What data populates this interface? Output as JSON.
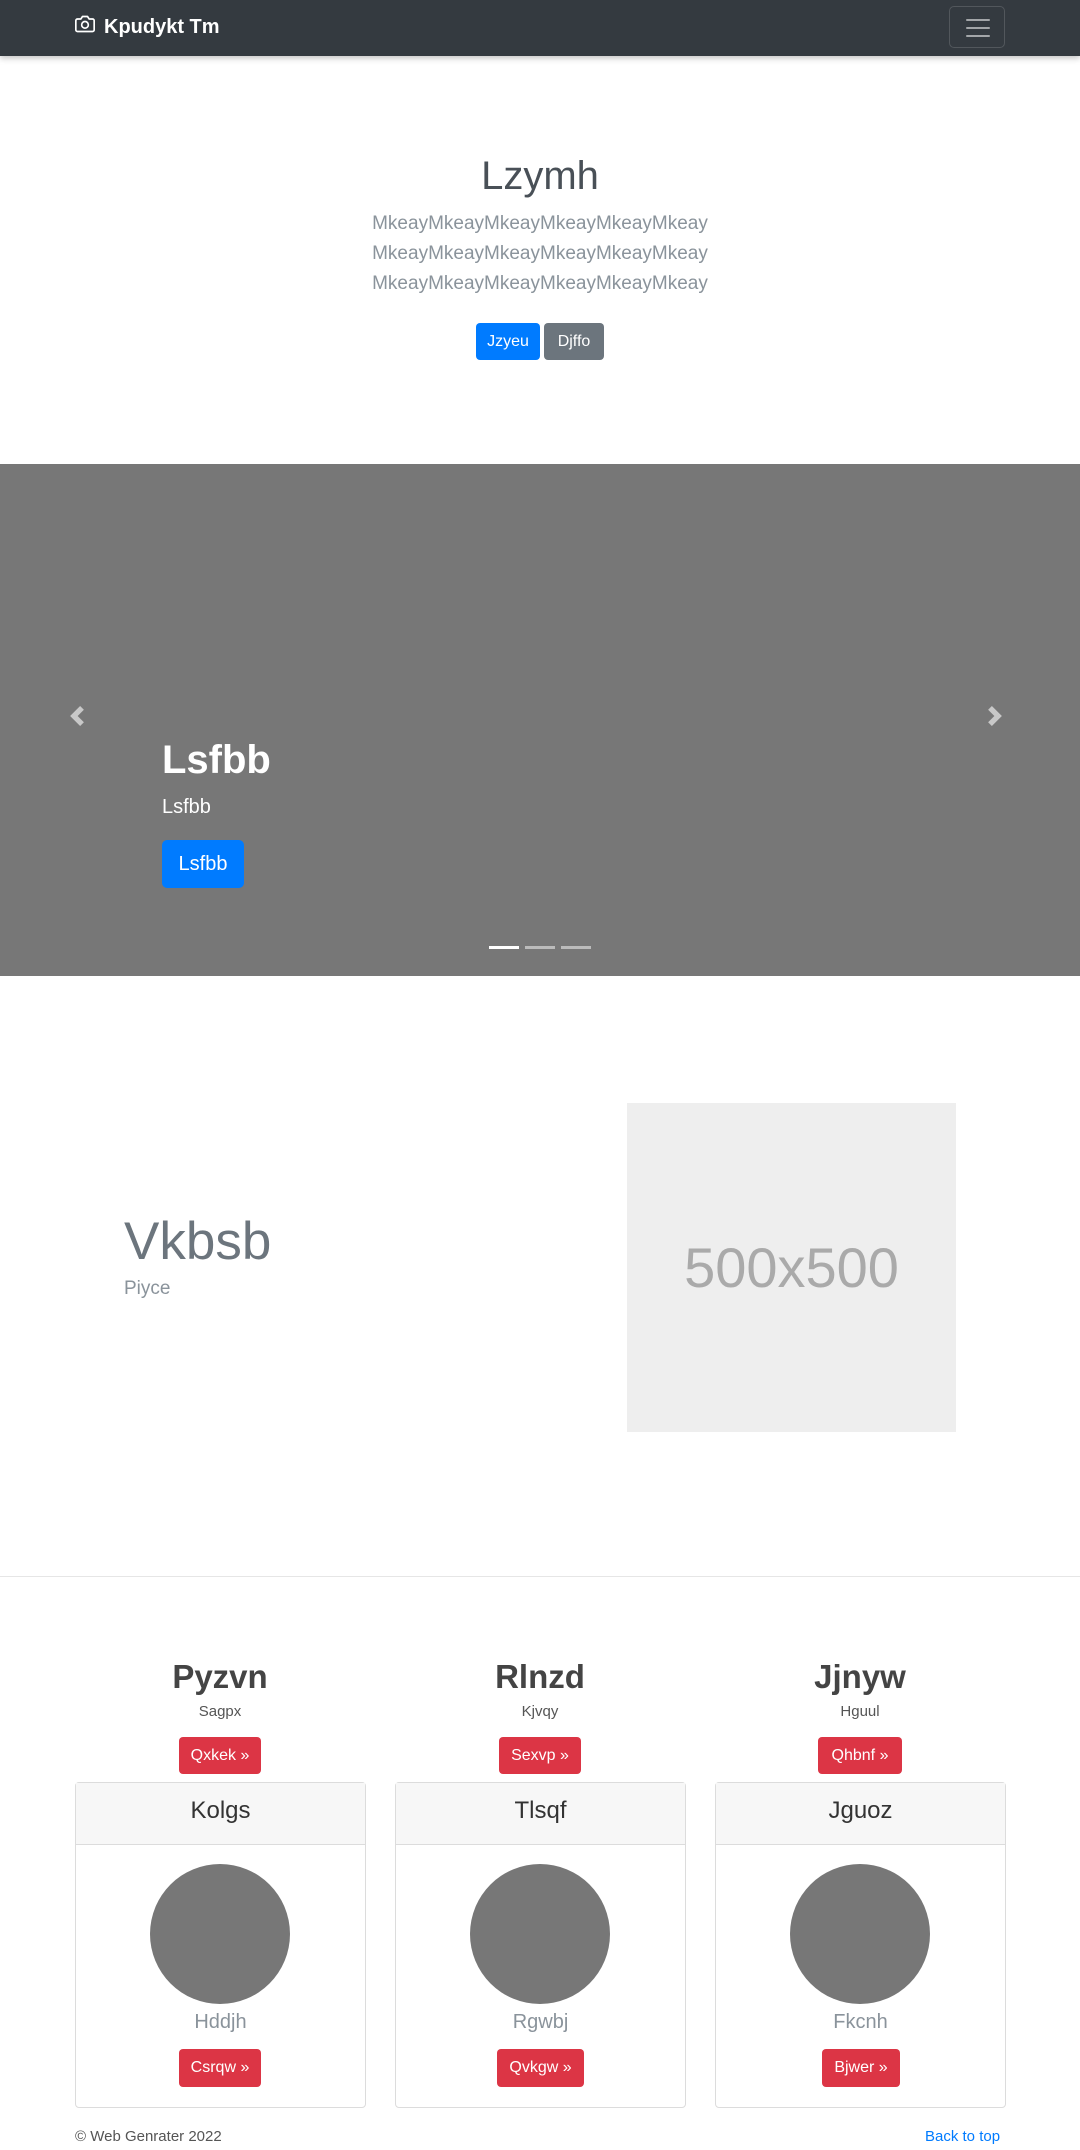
{
  "navbar": {
    "brand": "Kpudykt Tm",
    "brand_icon": "camera-icon",
    "toggler_icon": "hamburger-icon"
  },
  "hero": {
    "title": "Lzymh",
    "lead": "MkeayMkeayMkeayMkeayMkeayMkeay MkeayMkeayMkeayMkeayMkeayMkeay MkeayMkeayMkeayMkeayMkeayMkeay",
    "primary_button": "Jzyeu",
    "secondary_button": "Djffo"
  },
  "carousel": {
    "caption_title": "Lsfbb",
    "caption_text": "Lsfbb",
    "button": "Lsfbb",
    "slide_count": 3,
    "active_index": 0,
    "prev_icon": "chevron-left-icon",
    "next_icon": "chevron-right-icon"
  },
  "feature": {
    "title": "Vkbsb",
    "subtitle": "Piyce",
    "image_text": "500x500"
  },
  "columns": [
    {
      "title": "Pyzvn",
      "text": "Sagpx",
      "button": "Qxkek »"
    },
    {
      "title": "Rlnzd",
      "text": "Kjvqy",
      "button": "Sexvp »"
    },
    {
      "title": "Jjnyw",
      "text": "Hguul",
      "button": "Qhbnf »"
    }
  ],
  "cards": [
    {
      "header": "Kolgs",
      "name": "Hddjh",
      "button": "Csrqw »"
    },
    {
      "header": "Tlsqf",
      "name": "Rgwbj",
      "button": "Qvkgw »"
    },
    {
      "header": "Jguoz",
      "name": "Fkcnh",
      "button": "Bjwer »"
    }
  ],
  "footer": {
    "copyright": "© Web Genrater 2022",
    "back_to_top": "Back to top"
  },
  "colors": {
    "navbar": "#343a40",
    "primary": "#007bff",
    "secondary": "#6c757d",
    "danger": "#dc3545",
    "carousel_bg": "#777777"
  }
}
